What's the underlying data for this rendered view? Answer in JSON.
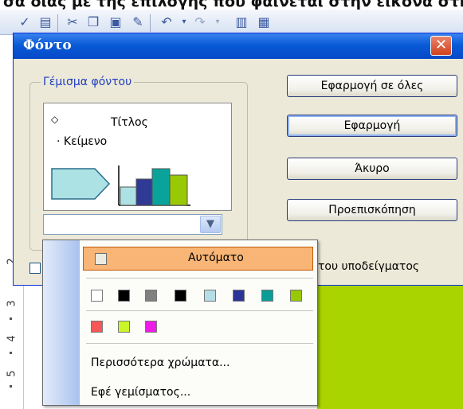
{
  "background": {
    "top_caption": "σα διάς με της επιλογής που φαίνεται στην εικόνα στη",
    "toolbar_icons": [
      "spell-check-icon",
      "research-icon",
      "cut-icon",
      "copy-icon",
      "paste-icon",
      "format-painter-icon",
      "undo-icon",
      "undo-dropdown-icon",
      "redo-icon",
      "redo-dropdown-icon",
      "chart-icon",
      "table-icon"
    ],
    "ruler_numbers": [
      "2",
      "3",
      "4",
      "5"
    ],
    "slide_color": "#aad400"
  },
  "dialog": {
    "title": "Φόντο",
    "close_glyph": "✕",
    "group_label": "Γέμισμα φόντου",
    "preview": {
      "title": "Τίτλος",
      "body": "Κείμενο",
      "chart_colors": [
        "#ade2e4",
        "#2f3a95",
        "#0aa39c",
        "#99c805"
      ]
    },
    "buttons": {
      "apply_all": "Εφαρμογή σε όλες",
      "apply": "Εφαρμογή",
      "cancel": "Άκυρο",
      "preview": "Προεπισκόπηση"
    },
    "checkbox_label_visible": "του υποδείγματος"
  },
  "color_menu": {
    "automatic": "Αυτόματο",
    "swatches_row1": [
      "#ffffff",
      "#000000",
      "#808080",
      "#000000",
      "#b4dde6",
      "#2d3497",
      "#0b9d96",
      "#99c805"
    ],
    "swatches_row2": [
      "#f65656",
      "#c9f52a",
      "#ee1ce6"
    ],
    "more_colors": "Περισσότερα χρώματα...",
    "fill_effects": "Εφέ γεμίσματος..."
  }
}
